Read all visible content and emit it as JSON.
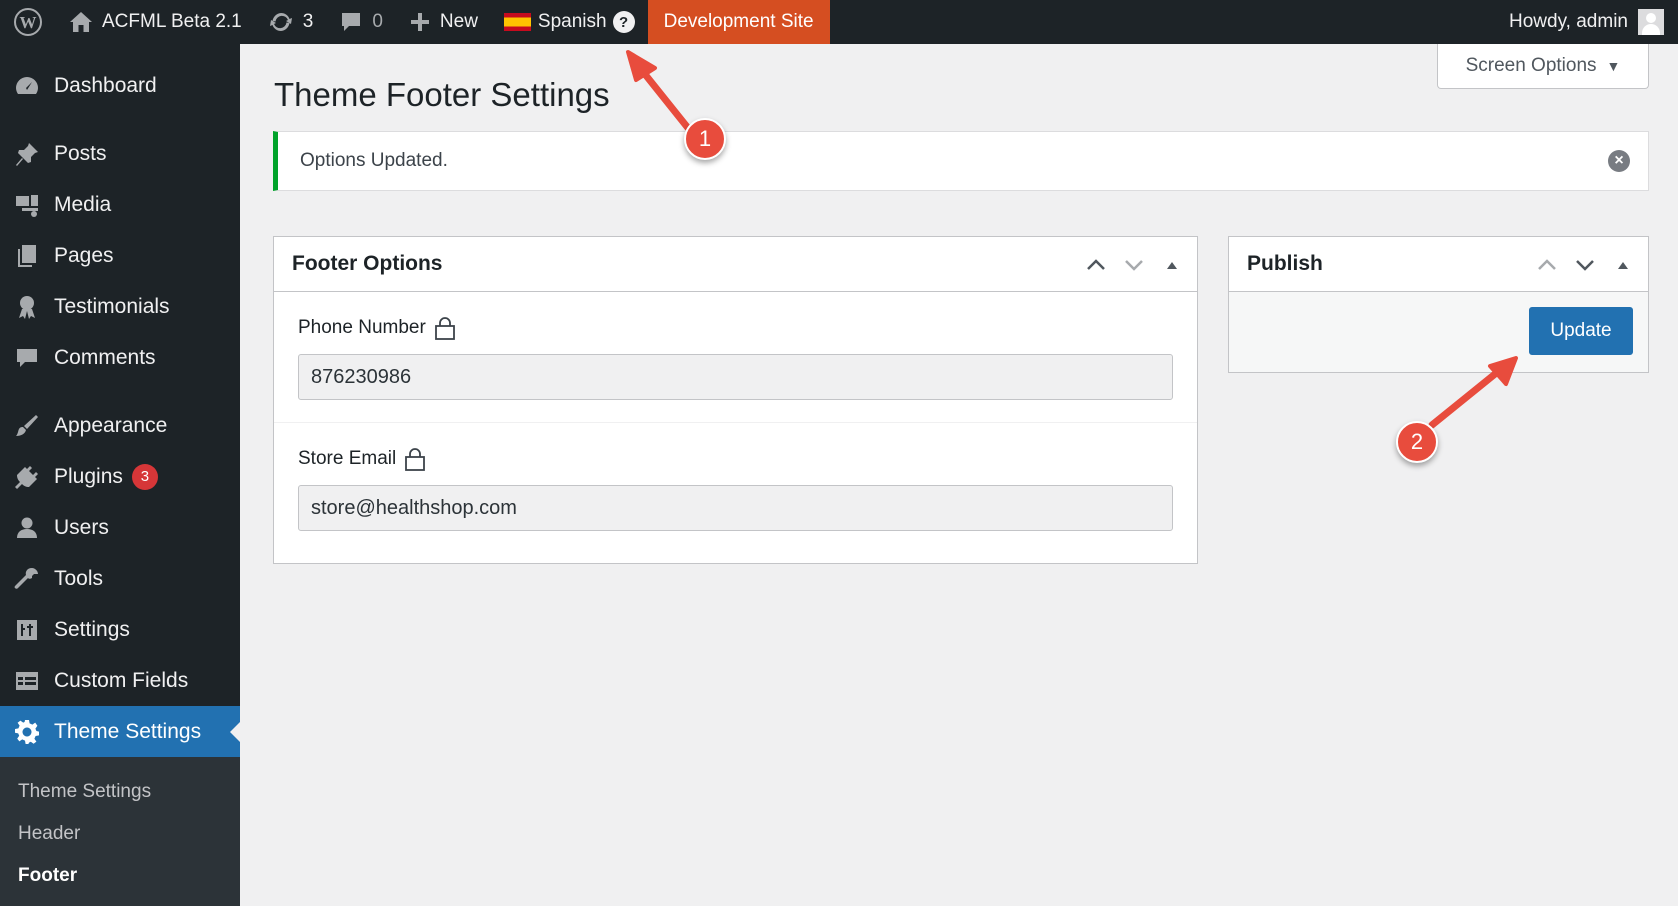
{
  "adminbar": {
    "site_name": "ACFML Beta 2.1",
    "updates_count": "3",
    "comments_count": "0",
    "new_label": "New",
    "language_label": "Spanish",
    "help_label": "?",
    "env_label": "Development Site",
    "greeting": "Howdy, admin"
  },
  "sidebar": {
    "items": [
      {
        "label": "Dashboard"
      },
      {
        "label": "Posts"
      },
      {
        "label": "Media"
      },
      {
        "label": "Pages"
      },
      {
        "label": "Testimonials"
      },
      {
        "label": "Comments"
      },
      {
        "label": "Appearance"
      },
      {
        "label": "Plugins",
        "badge": "3"
      },
      {
        "label": "Users"
      },
      {
        "label": "Tools"
      },
      {
        "label": "Settings"
      },
      {
        "label": "Custom Fields"
      },
      {
        "label": "Theme Settings"
      }
    ],
    "submenu": [
      {
        "label": "Theme Settings"
      },
      {
        "label": "Header"
      },
      {
        "label": "Footer"
      }
    ]
  },
  "screen_options": {
    "label": "Screen Options"
  },
  "page": {
    "title": "Theme Footer Settings"
  },
  "notice": {
    "text": "Options Updated."
  },
  "footer_options": {
    "title": "Footer Options",
    "fields": [
      {
        "label": "Phone Number",
        "value": "876230986"
      },
      {
        "label": "Store Email",
        "value": "store@healthshop.com"
      }
    ]
  },
  "publish": {
    "title": "Publish",
    "update_label": "Update"
  },
  "annotations": {
    "marker_1": "1",
    "marker_2": "2"
  },
  "colors": {
    "accent": "#2271b1",
    "admin_bar": "#1d2327",
    "env_badge": "#d54e21",
    "notice_success": "#00a32a",
    "annotation": "#e84c3d",
    "badge": "#d63638"
  }
}
